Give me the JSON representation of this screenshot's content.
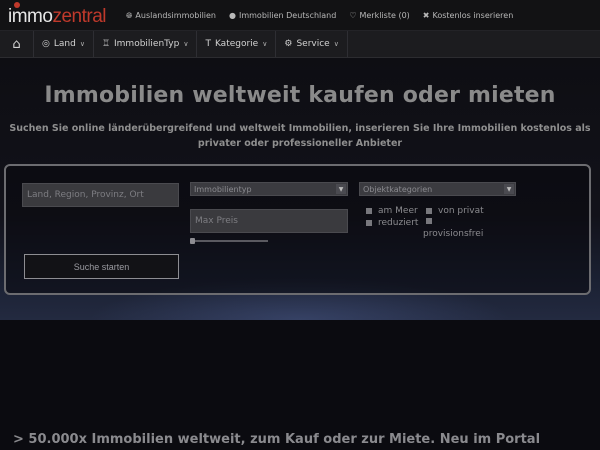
{
  "header": {
    "logo": {
      "part1": "immo",
      "part2": "zentral"
    },
    "links": [
      {
        "icon": "globe-icon",
        "label": "Auslandsimmobilien"
      },
      {
        "icon": "map-marker-icon",
        "label": "Immobilien Deutschland"
      },
      {
        "icon": "heart-icon",
        "label": "Merkliste (0)"
      },
      {
        "icon": "wrench-icon",
        "label": "Kostenlos inserieren"
      }
    ]
  },
  "nav": {
    "items": [
      {
        "icon": "globe-icon",
        "label": "Land"
      },
      {
        "icon": "bank-icon",
        "label": "ImmobilienTyp"
      },
      {
        "icon": "tag-icon",
        "label": "Kategorie"
      },
      {
        "icon": "gear-icon",
        "label": "Service"
      }
    ]
  },
  "hero": {
    "title": "Immobilien weltweit kaufen oder mieten",
    "subtitle": "Suchen Sie online länderübergreifend und weltweit Immobilien, inserieren Sie Ihre Immobilien kostenlos als privater oder professioneller Anbieter"
  },
  "search": {
    "location_placeholder": "Land, Region, Provinz, Ort",
    "type_select": "Immobilientyp",
    "category_select": "Objektkategorien",
    "price_placeholder": "Max Preis",
    "checkboxes": {
      "meer": "am Meer",
      "privat": "von privat",
      "reduziert": "reduziert",
      "provisionsfrei": "provisionsfrei"
    },
    "button": "Suche starten"
  },
  "tagline": "> 50.000x Immobilien weltweit, zum Kauf oder zur Miete. Neu im Portal"
}
